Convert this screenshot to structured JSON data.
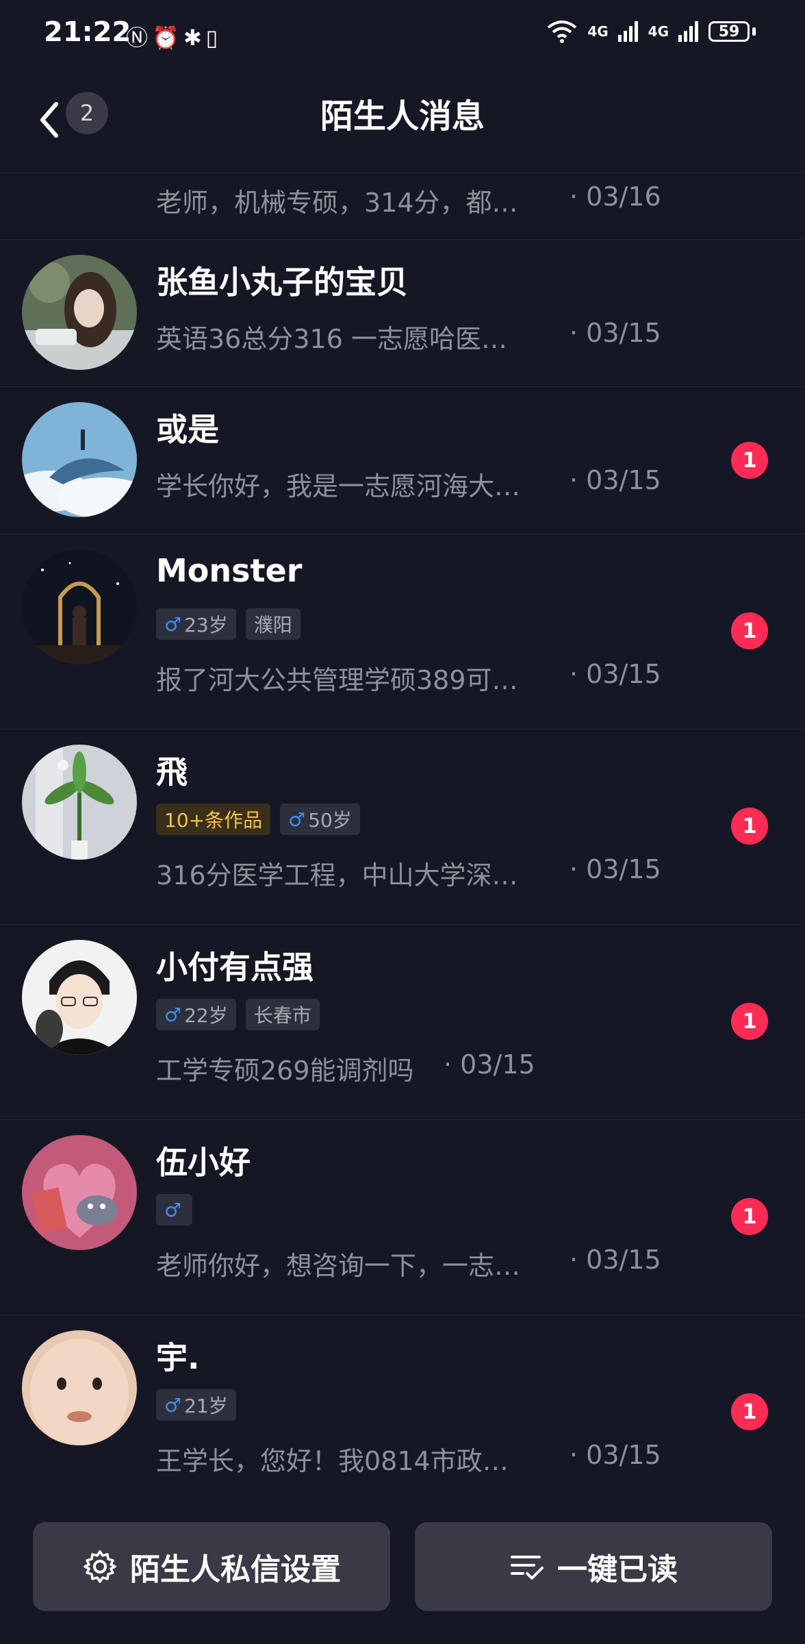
{
  "status_bar": {
    "time": "21:22",
    "left_icons": [
      "nfc-icon",
      "alarm-icon",
      "bluetooth-icon",
      "vibrate-icon"
    ],
    "signal_1": "4G",
    "signal_2": "4G",
    "battery": "59"
  },
  "header": {
    "back_badge": "2",
    "title": "陌生人消息"
  },
  "messages": [
    {
      "name": "",
      "preview": "老师，机械专硕，314分，都…",
      "date": "· 03/16",
      "unread": ""
    },
    {
      "name": "张鱼小丸子的宝贝",
      "preview": "英语36总分316 一志愿哈医…",
      "date": "· 03/15",
      "unread": ""
    },
    {
      "name": "或是",
      "preview": "学长你好，我是一志愿河海大…",
      "date": "· 03/15",
      "unread": "1"
    },
    {
      "name": "Monster",
      "tags": [
        "♂",
        "23岁",
        "濮阳"
      ],
      "preview": "报了河大公共管理学硕389可…",
      "date": "· 03/15",
      "unread": "1"
    },
    {
      "name": "飛",
      "tags": [
        "10+条作品",
        "♂",
        "50岁"
      ],
      "preview": "316分医学工程，中山大学深…",
      "date": "· 03/15",
      "unread": "1"
    },
    {
      "name": "小付有点强",
      "tags": [
        "♂",
        "22岁",
        "长春市"
      ],
      "preview": "工学专硕269能调剂吗",
      "date": "· 03/15",
      "unread": "1"
    },
    {
      "name": "伍小好",
      "tags": [
        "♂"
      ],
      "preview": "老师你好，想咨询一下，一志…",
      "date": "· 03/15",
      "unread": "1"
    },
    {
      "name": "宇.",
      "tags": [
        "♂",
        "21岁"
      ],
      "preview": "王学长，您好！我0814市政…",
      "date": "· 03/15",
      "unread": "1"
    }
  ],
  "bottom_bar": {
    "settings_label": "陌生人私信设置",
    "settings_icon": "gear-icon",
    "mark_read_label": "一键已读",
    "mark_read_icon": "list-check-icon"
  },
  "colors": {
    "background": "#161724",
    "badge": "#fe2c55",
    "male": "#3c8cf0",
    "works_tag": "#f5c346"
  }
}
